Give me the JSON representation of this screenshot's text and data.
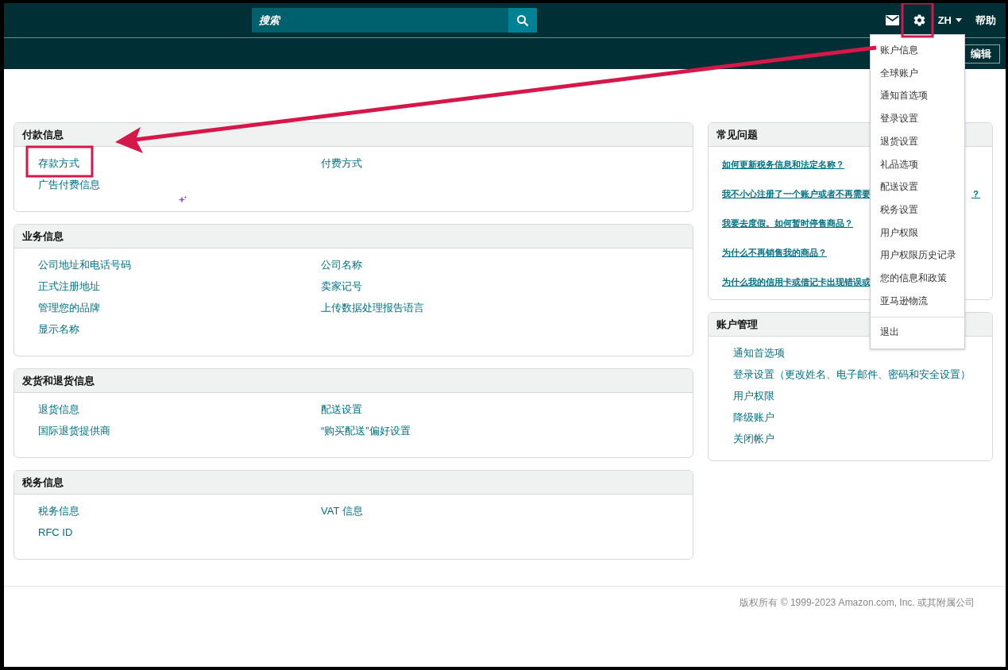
{
  "header": {
    "search": {
      "placeholder": "搜索"
    },
    "language": "ZH",
    "help": "帮助",
    "edit_button": "编辑"
  },
  "settings_menu": {
    "items": [
      "账户信息",
      "全球账户",
      "通知首选项",
      "登录设置",
      "退货设置",
      "礼品选项",
      "配送设置",
      "税务设置",
      "用户权限",
      "用户权限历史记录",
      "您的信息和政策",
      "亚马逊物流"
    ],
    "footer_item": "退出"
  },
  "sections": [
    {
      "title": "付款信息",
      "links": [
        "存款方式",
        "付费方式",
        "广告付费信息"
      ]
    },
    {
      "title": "业务信息",
      "links": [
        "公司地址和电话号码",
        "公司名称",
        "正式注册地址",
        "卖家记号",
        "管理您的品牌",
        "上传数据处理报告语言",
        "显示名称"
      ]
    },
    {
      "title": "发货和退货信息",
      "links": [
        "退货信息",
        "配送设置",
        "国际退货提供商",
        "“购买配送”偏好设置"
      ]
    },
    {
      "title": "税务信息",
      "links": [
        "税务信息",
        "VAT 信息",
        "RFC ID"
      ]
    }
  ],
  "faq": {
    "title": "常见问题",
    "items": [
      {
        "text": "如何更新税务信息和法定名称？"
      },
      {
        "text": "我不小心注册了一个账户或者不再需要",
        "tail": "？"
      },
      {
        "text": "我要去度假。如何暂时停售商品？"
      },
      {
        "text": "为什么不再销售我的商品？"
      },
      {
        "text": "为什么我的信用卡或借记卡出现错误或"
      }
    ]
  },
  "account_management": {
    "title": "账户管理",
    "links": [
      "通知首选项",
      "登录设置（更改姓名、电子邮件、密码和安全设置）",
      "用户权限",
      "降级账户",
      "关闭帐户"
    ]
  },
  "footer": "版权所有 © 1999-2023 Amazon.com, Inc. 或其附属公司"
}
